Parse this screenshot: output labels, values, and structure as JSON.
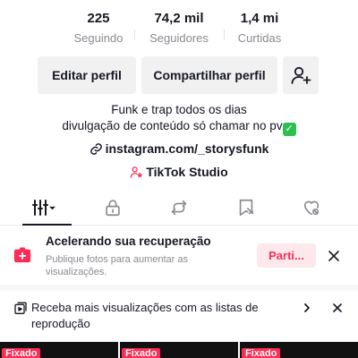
{
  "stats": [
    {
      "value": "225",
      "label": "Seguindo"
    },
    {
      "value": "74,2 mil",
      "label": "Seguidores"
    },
    {
      "value": "1,4 mi",
      "label": "Curtidas"
    }
  ],
  "actions": {
    "edit_label": "Editar perfil",
    "share_label": "Compartilhar perfil",
    "add_friend_icon": "add-friend-icon"
  },
  "bio": {
    "line1": "Funk e trap todos os dias",
    "line2": "divulgação de conteúdo só chamar no pv",
    "check_glyph": "✓",
    "link": "instagram.com/_storysfunk",
    "studio": "TikTok Studio"
  },
  "tabs": [
    {
      "name": "videos-grid",
      "icon": "grid-icon",
      "active": true
    },
    {
      "name": "private",
      "icon": "lock-icon",
      "active": false
    },
    {
      "name": "reposts",
      "icon": "repost-icon",
      "active": false
    },
    {
      "name": "favorites",
      "icon": "bookmark-icon",
      "active": false
    },
    {
      "name": "liked",
      "icon": "liked-icon",
      "active": false
    }
  ],
  "recovery_banner": {
    "title": "Acelerando sua recuperação",
    "subtitle": "Publique fotos para aumentar as visualizações.",
    "button_label": "Parti..."
  },
  "playlist_banner": {
    "text": "Receba mais visualizações com as listas de reprodução"
  },
  "grid": {
    "pinned_label": "Fixado"
  },
  "colors": {
    "accent": "#fe2c55",
    "accent_soft": "#fde8ec",
    "muted": "#8a8b91",
    "button_bg": "#f1f1f2",
    "text": "#161823",
    "check_green": "#2fbf50"
  }
}
